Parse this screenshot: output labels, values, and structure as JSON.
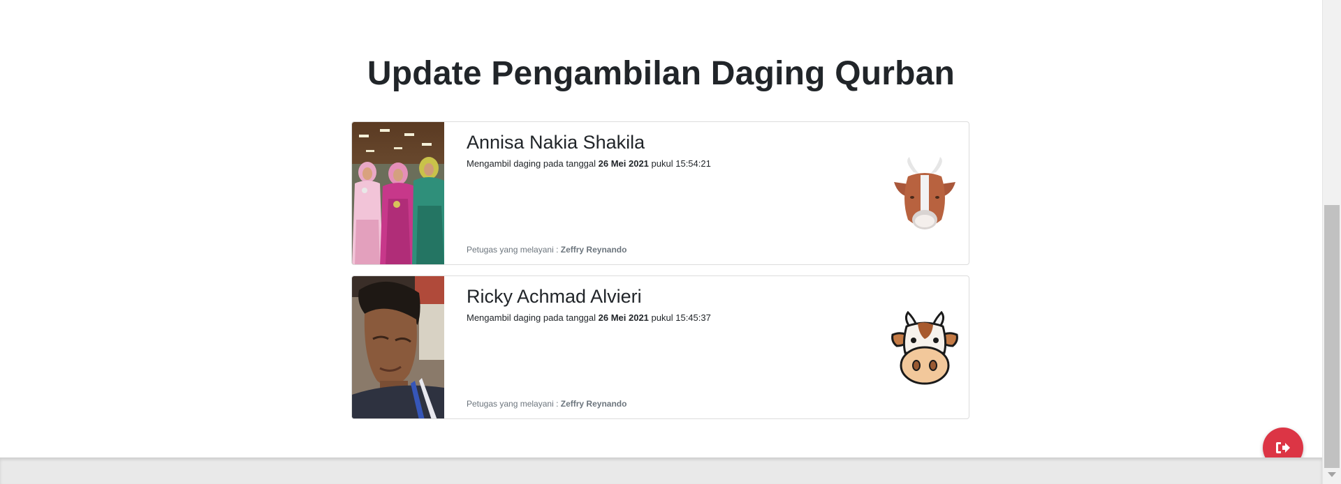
{
  "page": {
    "title": "Update Pengambilan Daging Qurban"
  },
  "records": [
    {
      "name": "Annisa Nakia Shakila",
      "text_prefix": "Mengambil daging pada tanggal ",
      "date": "26 Mei 2021",
      "text_middle": " pukul ",
      "time": "15:54:21",
      "officer_label": "Petugas yang melayani : ",
      "officer_name": "Zeffry Reynando",
      "animal_icon": "goat-icon",
      "photo": "group-photo-three-women-in-hijab"
    },
    {
      "name": "Ricky Achmad Alvieri",
      "text_prefix": "Mengambil daging pada tanggal ",
      "date": "26 Mei 2021",
      "text_middle": " pukul ",
      "time": "15:45:37",
      "officer_label": "Petugas yang melayani : ",
      "officer_name": "Zeffry Reynando",
      "animal_icon": "cow-icon",
      "photo": "portrait-young-man"
    }
  ],
  "fab": {
    "icon": "logout-icon",
    "color": "#dc3545"
  },
  "colors": {
    "text": "#212529",
    "muted": "#6c757d",
    "danger": "#dc3545"
  }
}
